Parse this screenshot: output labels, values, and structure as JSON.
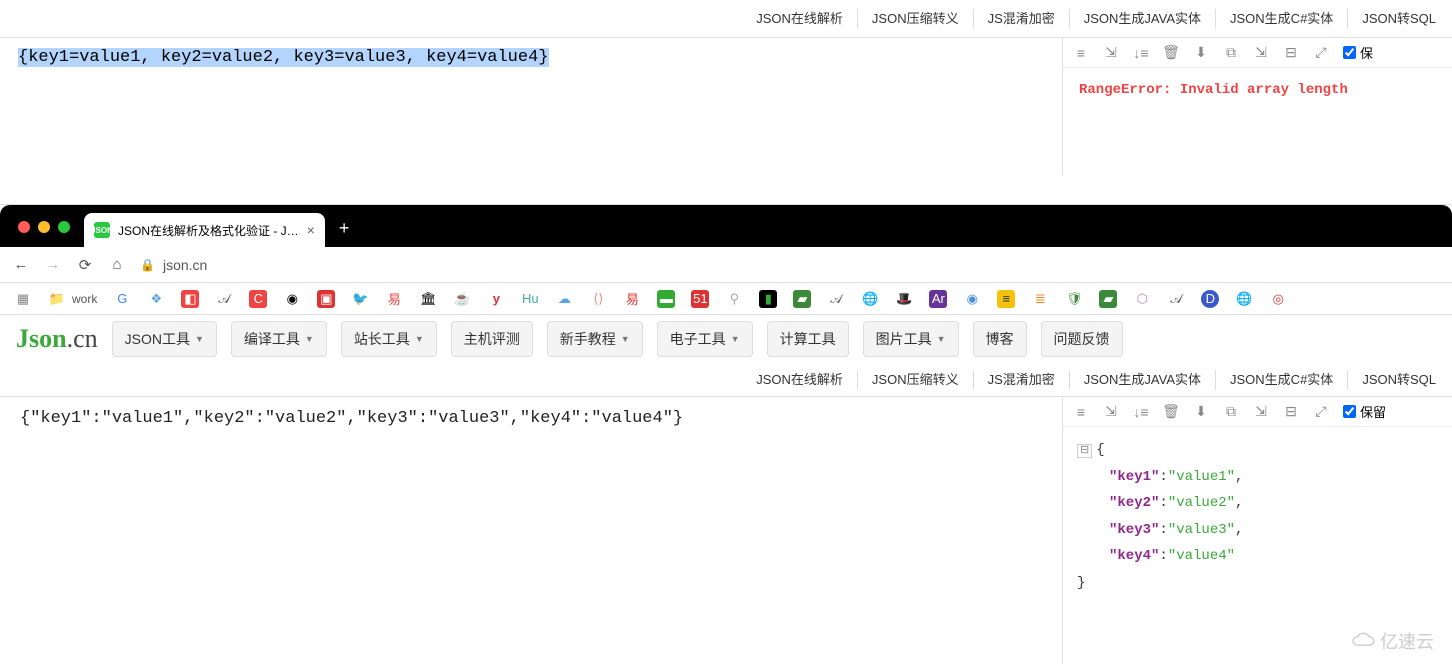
{
  "upper": {
    "sub_tabs": [
      "JSON在线解析",
      "JSON压缩转义",
      "JS混淆加密",
      "JSON生成JAVA实体",
      "JSON生成C#实体",
      "JSON转SQL"
    ],
    "input_text": "{key1=value1, key2=value2, key3=value3, key4=value4}",
    "error_text": "RangeError: Invalid array length",
    "save_label": "保"
  },
  "browser": {
    "tab_title": "JSON在线解析及格式化验证 - J…",
    "url": "json.cn",
    "bookmarks": {
      "work": "work"
    }
  },
  "app": {
    "logo_main": "Json",
    "logo_suffix": ".cn",
    "menus": [
      {
        "label": "JSON工具",
        "caret": true
      },
      {
        "label": "编译工具",
        "caret": true
      },
      {
        "label": "站长工具",
        "caret": true
      },
      {
        "label": "主机评测",
        "caret": false
      },
      {
        "label": "新手教程",
        "caret": true
      },
      {
        "label": "电子工具",
        "caret": true
      },
      {
        "label": "计算工具",
        "caret": false
      },
      {
        "label": "图片工具",
        "caret": true
      },
      {
        "label": "博客",
        "caret": false
      },
      {
        "label": "问题反馈",
        "caret": false
      }
    ],
    "sub_tabs": [
      "JSON在线解析",
      "JSON压缩转义",
      "JS混淆加密",
      "JSON生成JAVA实体",
      "JSON生成C#实体",
      "JSON转SQL"
    ],
    "input_text": "{\"key1\":\"value1\",\"key2\":\"value2\",\"key3\":\"value3\",\"key4\":\"value4\"}",
    "save_label": "保留",
    "formatted": {
      "open": "{",
      "close": "}",
      "pairs": [
        {
          "key": "\"key1\"",
          "val": "\"value1\"",
          "comma": ","
        },
        {
          "key": "\"key2\"",
          "val": "\"value2\"",
          "comma": ","
        },
        {
          "key": "\"key3\"",
          "val": "\"value3\"",
          "comma": ","
        },
        {
          "key": "\"key4\"",
          "val": "\"value4\"",
          "comma": ""
        }
      ]
    }
  },
  "watermark": "亿速云"
}
